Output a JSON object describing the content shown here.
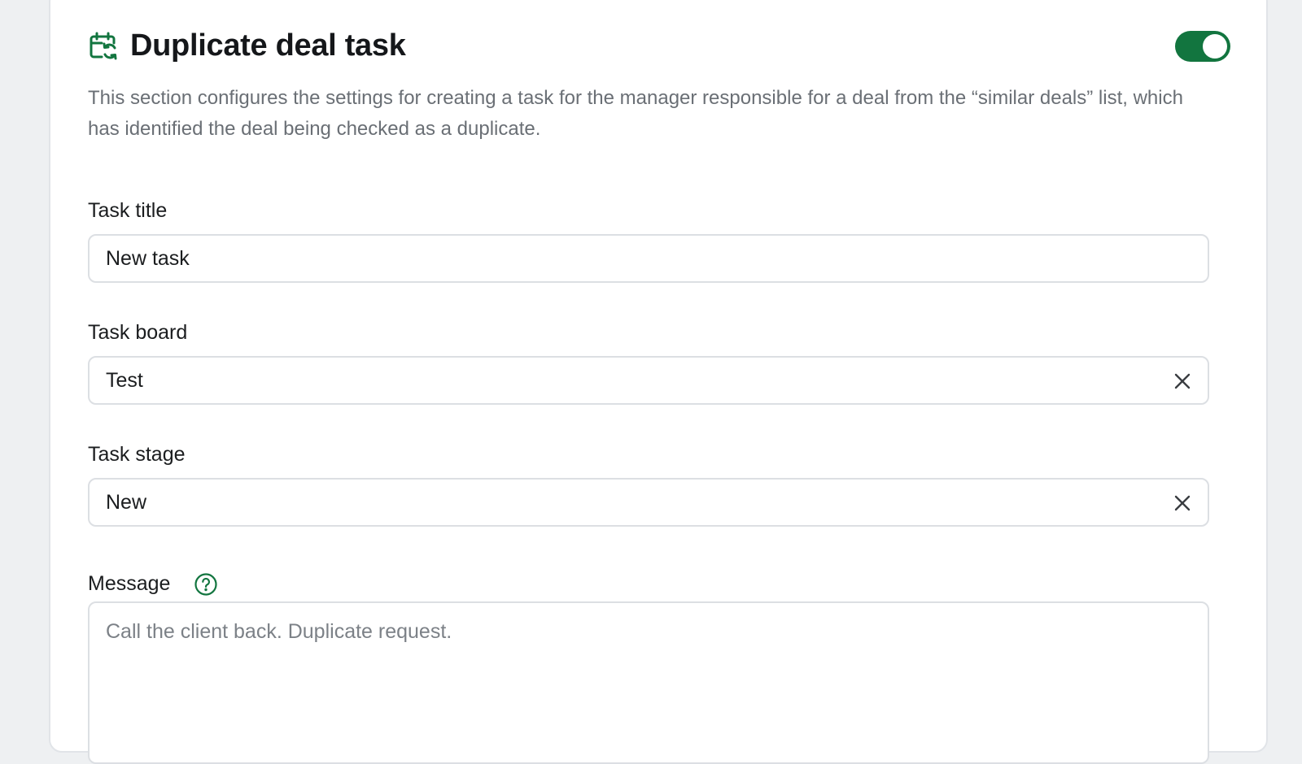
{
  "section": {
    "title": "Duplicate deal task",
    "icon": "calendar-refresh-icon",
    "enabled": true,
    "accent_color": "#12753f",
    "description": "This section configures the settings for creating a task for the manager responsible for a deal from the “similar deals” list, which has identified the deal being checked as a duplicate."
  },
  "fields": {
    "task_title": {
      "label": "Task title",
      "value": "New task"
    },
    "task_board": {
      "label": "Task board",
      "value": "Test",
      "clear_icon": "close-icon"
    },
    "task_stage": {
      "label": "Task stage",
      "value": "New",
      "clear_icon": "close-icon"
    },
    "message": {
      "label": "Message",
      "help_icon": "question-circle-icon",
      "placeholder": "Call the client back. Duplicate request."
    }
  }
}
